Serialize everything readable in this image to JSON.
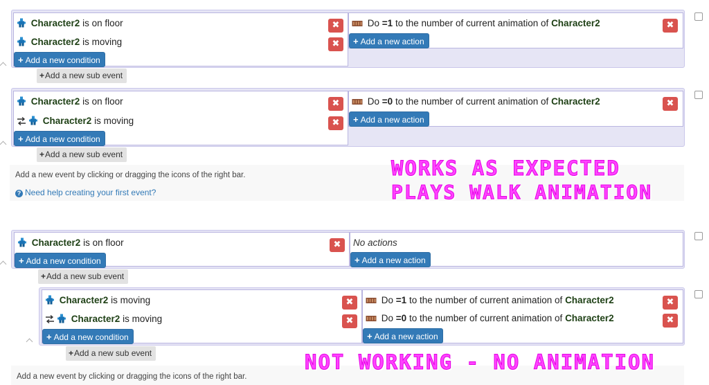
{
  "events": [
    {
      "conditions": [
        {
          "subject": "Character2",
          "text": "is on floor",
          "inverted": false
        },
        {
          "subject": "Character2",
          "text": "is moving",
          "inverted": false
        }
      ],
      "actions": [
        {
          "prefix": "Do ",
          "value": "=1",
          "text": " to the number of current animation of ",
          "subject": "Character2"
        }
      ]
    },
    {
      "conditions": [
        {
          "subject": "Character2",
          "text": "is on floor",
          "inverted": false
        },
        {
          "subject": "Character2",
          "text": "is moving",
          "inverted": true
        }
      ],
      "actions": [
        {
          "prefix": "Do ",
          "value": "=0",
          "text": " to the number of current animation of ",
          "subject": "Character2"
        }
      ]
    },
    {
      "conditions": [
        {
          "subject": "Character2",
          "text": "is on floor",
          "inverted": false
        }
      ],
      "no_actions": "No actions"
    },
    {
      "conditions": [
        {
          "subject": "Character2",
          "text": "is moving",
          "inverted": false
        },
        {
          "subject": "Character2",
          "text": "is moving",
          "inverted": true
        }
      ],
      "actions": [
        {
          "prefix": "Do ",
          "value": "=1",
          "text": " to the number of current animation of ",
          "subject": "Character2"
        },
        {
          "prefix": "Do ",
          "value": "=0",
          "text": " to the number of current animation of ",
          "subject": "Character2"
        }
      ]
    }
  ],
  "labels": {
    "add_condition": "Add a new condition",
    "add_action": "Add a new action",
    "add_sub_event": "Add a new sub event",
    "add_event_hint": "Add a new event by clicking or dragging the icons of the right bar.",
    "help_link": "Need help creating your first event?",
    "delete_glyph": "✖",
    "plus_glyph": "+"
  },
  "overlays": {
    "works_line1": "WORKS AS EXPECTED",
    "works_line2": "PLAYS WALK ANIMATION",
    "not_working": "NOT WORKING - NO ANIMATION"
  },
  "colors": {
    "delete_red": "#d9534f",
    "action_blue": "#337ab7",
    "event_bg": "#e6e5f5",
    "object_name": "#1d3f14",
    "overlay_magenta": "#ff44ff"
  },
  "icons": {
    "object": "sprite-object-icon",
    "variable": "variable-icon",
    "invert": "invert-condition-icon",
    "help": "help-icon"
  }
}
